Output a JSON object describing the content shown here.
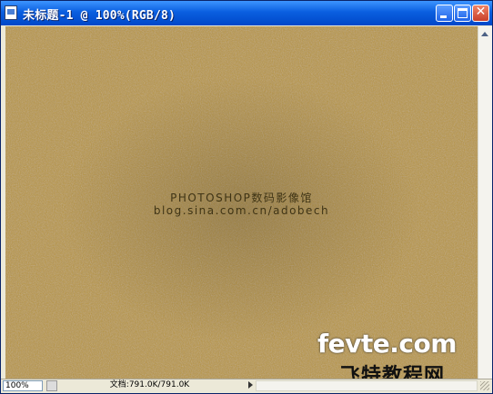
{
  "window": {
    "title": "未标题-1 @ 100%(RGB/8)"
  },
  "title_buttons": {
    "minimize_icon": "minimize-icon",
    "maximize_icon": "maximize-icon",
    "close_icon": "close-icon",
    "close_glyph": "✕"
  },
  "canvas": {
    "watermark_line1": "PHOTOSHOP数码影像馆",
    "watermark_line2": "blog.sina.com.cn/adobech",
    "logo_text": "fevte.com",
    "logo_cn": "飞特教程网",
    "fill_color": "#b8953a"
  },
  "statusbar": {
    "zoom": "100%",
    "doc_info": "文档:791.0K/791.0K"
  }
}
